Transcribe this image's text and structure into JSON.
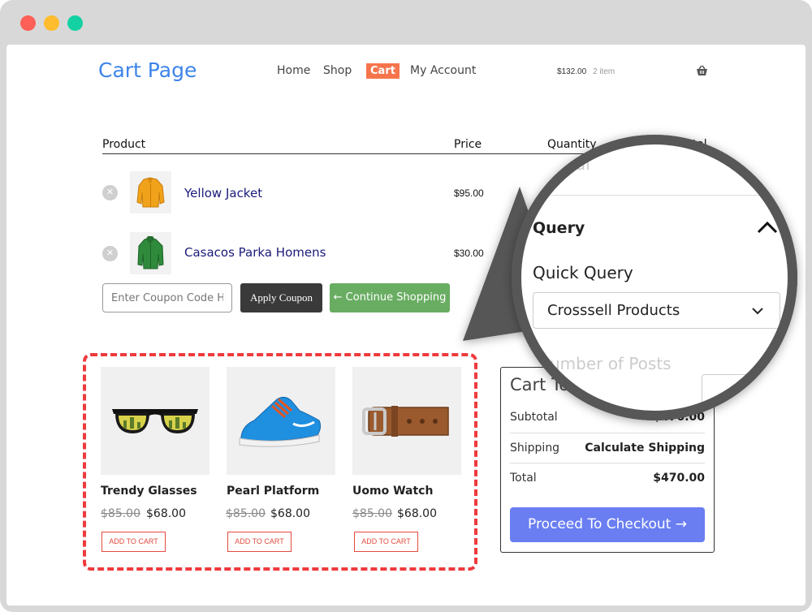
{
  "window": {
    "controls": [
      "close",
      "minimize",
      "maximize"
    ]
  },
  "header": {
    "site_title": "Cart Page",
    "nav": [
      {
        "label": "Home",
        "active": false
      },
      {
        "label": "Shop",
        "active": false
      },
      {
        "label": "Cart",
        "active": true
      },
      {
        "label": "My Account",
        "active": false
      }
    ],
    "mini_cart_price": "$132.00",
    "mini_cart_count": "2 item",
    "cart_icon": "basket-icon"
  },
  "cart_table": {
    "headers": {
      "product": "Product",
      "price": "Price",
      "quantity": "Quantity",
      "total": "Total"
    },
    "items": [
      {
        "name": "Yellow Jacket",
        "price": "$95.00",
        "image": "yellow-jacket-image"
      },
      {
        "name": "Casacos Parka Homens",
        "price": "$30.00",
        "image": "green-parka-image"
      }
    ]
  },
  "actions": {
    "coupon_placeholder": "Enter Coupon Code Here",
    "apply_coupon": "Apply Coupon",
    "continue_shopping": "← Continue Shopping"
  },
  "crosssells": [
    {
      "name": "Trendy Glasses",
      "old_price": "$85.00",
      "price": "$68.00",
      "button": "ADD TO CART",
      "image": "sunglasses-image"
    },
    {
      "name": "Pearl Platform",
      "old_price": "$85.00",
      "price": "$68.00",
      "button": "ADD TO CART",
      "image": "sneaker-image"
    },
    {
      "name": "Uomo Watch",
      "old_price": "$85.00",
      "price": "$68.00",
      "button": "ADD TO CART",
      "image": "belt-image"
    }
  ],
  "cart_totals": {
    "title": "Cart Totals",
    "subtotal_label": "Subtotal",
    "subtotal_value": "$470.00",
    "shipping_label": "Shipping",
    "shipping_value": "Calculate Shipping",
    "total_label": "Total",
    "total_value": "$470.00",
    "checkout": "Proceed To Checkout →"
  },
  "magnifier": {
    "faded_top": "Total",
    "section_title": "Query",
    "field_label": "Quick Query",
    "select_value": "Crosssell Products",
    "faded_bottom": "Number of Posts"
  },
  "colors": {
    "accent_blue": "#3d84ea",
    "nav_active": "#f6744b",
    "continue_green": "#69ad62",
    "dashed_red": "#ee3a3d",
    "checkout_blue": "#6a7ef2"
  }
}
